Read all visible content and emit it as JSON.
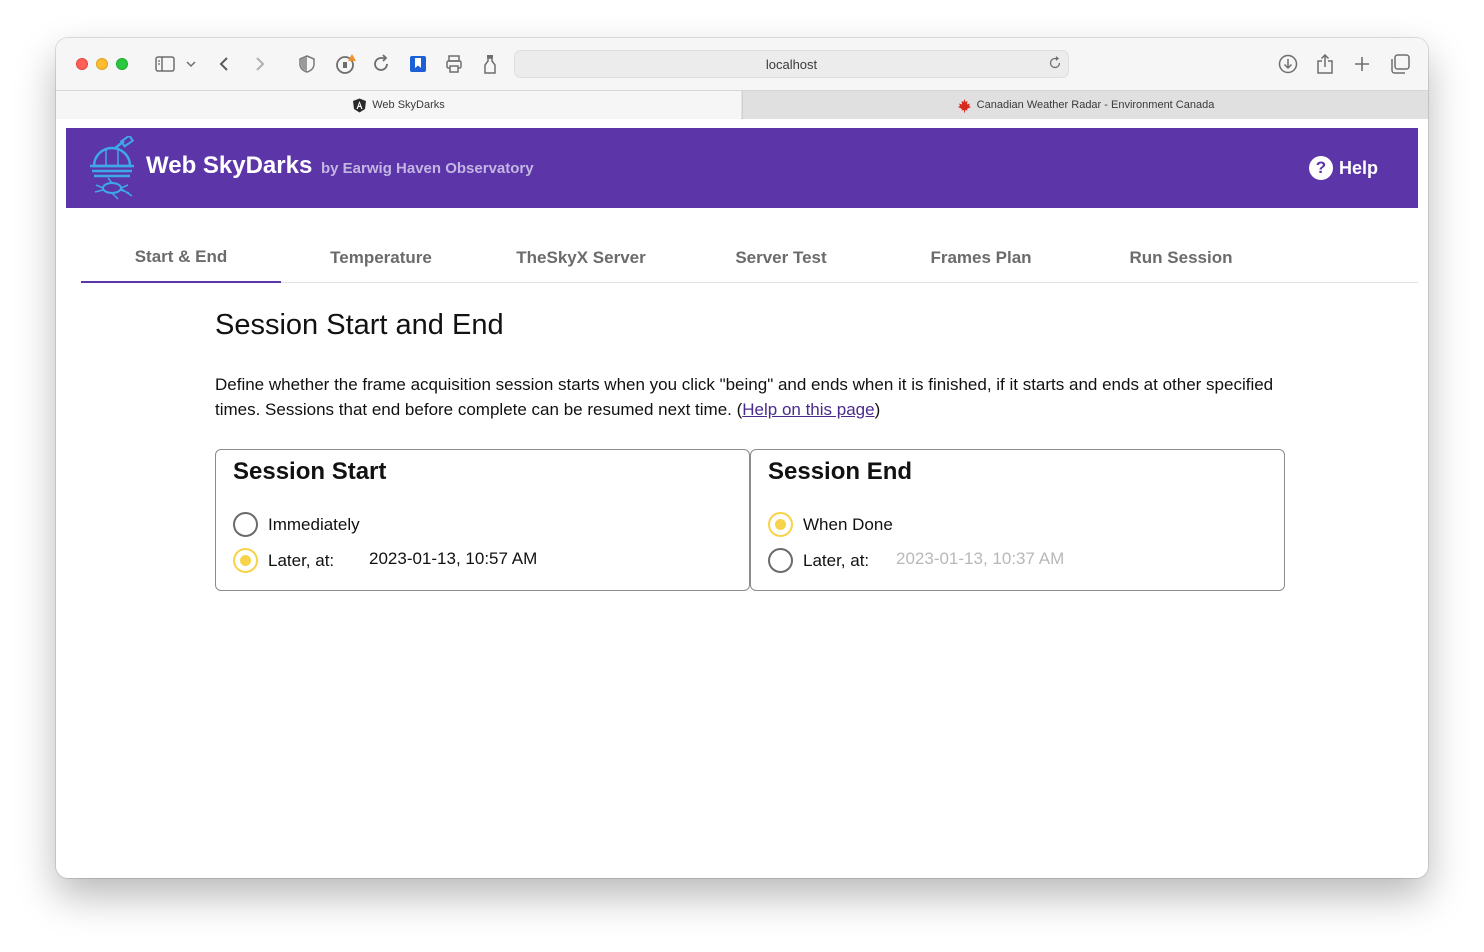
{
  "browser": {
    "url": "localhost",
    "tabs": [
      {
        "title": "Web SkyDarks",
        "active": true
      },
      {
        "title": "Canadian Weather Radar - Environment Canada",
        "active": false
      }
    ]
  },
  "app": {
    "title": "Web SkyDarks",
    "subtitle": "by Earwig Haven Observatory",
    "help_label": "Help",
    "brand_color": "#5c35a8"
  },
  "nav": {
    "tabs": [
      "Start & End",
      "Temperature",
      "TheSkyX Server",
      "Server Test",
      "Frames Plan",
      "Run Session"
    ],
    "active_index": 0
  },
  "main": {
    "heading": "Session Start and End",
    "description": "Define whether the frame acquisition session starts when you click \"being\" and ends when it is finished, if it starts and ends at other specified times. Sessions that end before complete can be resumed next time. (",
    "help_link": "Help on this page",
    "description_end": ")"
  },
  "session_start": {
    "title": "Session Start",
    "option_immediately": "Immediately",
    "option_later": "Later, at:",
    "selected": "later",
    "datetime": "2023-01-13, 10:57 AM"
  },
  "session_end": {
    "title": "Session End",
    "option_when_done": "When Done",
    "option_later": "Later, at:",
    "selected": "when_done",
    "datetime": "2023-01-13, 10:37 AM"
  }
}
